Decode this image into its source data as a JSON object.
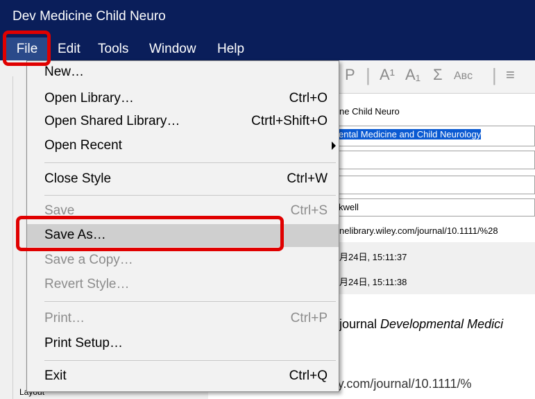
{
  "window": {
    "title": "Dev Medicine Child Neuro"
  },
  "menubar": [
    {
      "label": "File"
    },
    {
      "label": "Edit"
    },
    {
      "label": "Tools"
    },
    {
      "label": "Window"
    },
    {
      "label": "Help"
    }
  ],
  "file_menu": {
    "items": [
      {
        "label": "New…",
        "shortcut": ""
      },
      {
        "label": "Open Library…",
        "shortcut": "Ctrl+O"
      },
      {
        "label": "Open Shared Library…",
        "shortcut": "Ctrtl+Shift+O"
      },
      {
        "label": "Open Recent",
        "shortcut": ""
      },
      {
        "label": "Close Style",
        "shortcut": "Ctrl+W"
      },
      {
        "label": "Save",
        "shortcut": "Ctrl+S"
      },
      {
        "label": "Save As…",
        "shortcut": ""
      },
      {
        "label": "Save a Copy…",
        "shortcut": ""
      },
      {
        "label": "Revert Style…",
        "shortcut": ""
      },
      {
        "label": "Print…",
        "shortcut": "Ctrl+P"
      },
      {
        "label": "Print Setup…",
        "shortcut": ""
      },
      {
        "label": "Exit",
        "shortcut": "Ctrl+Q"
      }
    ],
    "highlighted": "Save As…"
  },
  "toolbar": {
    "plain_text": "P",
    "superscript": "A¹",
    "subscript": "A₁",
    "symbol": "Σ",
    "small_caps": "Aʙᴄ",
    "align": "≡"
  },
  "details": {
    "short_title": "ne Child Neuro",
    "full_title": "ental Medicine and Child Neurology",
    "author": "kwell",
    "url": "nelibrary.wiley.com/journal/10.1111/%28",
    "created": "月24日, 15:11:37",
    "modified": "月24日, 15:11:38",
    "description_prefix": "journal ",
    "description_italic": "Developmental Medici",
    "bottom_url": "http://onlinelibrary.wiley.com/journal/10.1111/%"
  },
  "left_panel": {
    "tree_item": "Layout"
  },
  "colors": {
    "titlebar": "#0a1e5a",
    "highlight_border": "#e00000",
    "selection": "#0a5ad2"
  }
}
